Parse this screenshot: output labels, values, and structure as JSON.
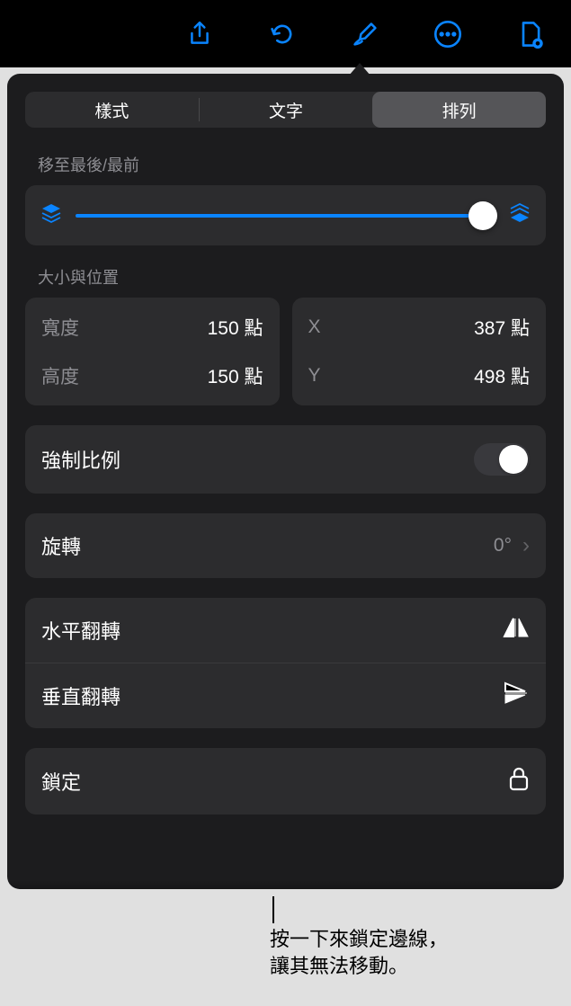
{
  "toolbar": {
    "icons": [
      "share",
      "undo",
      "format-brush",
      "more",
      "document"
    ]
  },
  "tabs": {
    "style": "樣式",
    "text": "文字",
    "arrange": "排列",
    "active": "arrange"
  },
  "move": {
    "label": "移至最後/最前"
  },
  "size": {
    "label": "大小與位置",
    "width_label": "寬度",
    "width_val": "150 點",
    "height_label": "高度",
    "height_val": "150 點",
    "x_label": "X",
    "x_val": "387 點",
    "y_label": "Y",
    "y_val": "498 點"
  },
  "constrain": {
    "label": "強制比例"
  },
  "rotate": {
    "label": "旋轉",
    "value": "0°"
  },
  "flip_h": {
    "label": "水平翻轉"
  },
  "flip_v": {
    "label": "垂直翻轉"
  },
  "lock": {
    "label": "鎖定"
  },
  "callout": {
    "line1": "按一下來鎖定邊線，",
    "line2": "讓其無法移動。"
  }
}
